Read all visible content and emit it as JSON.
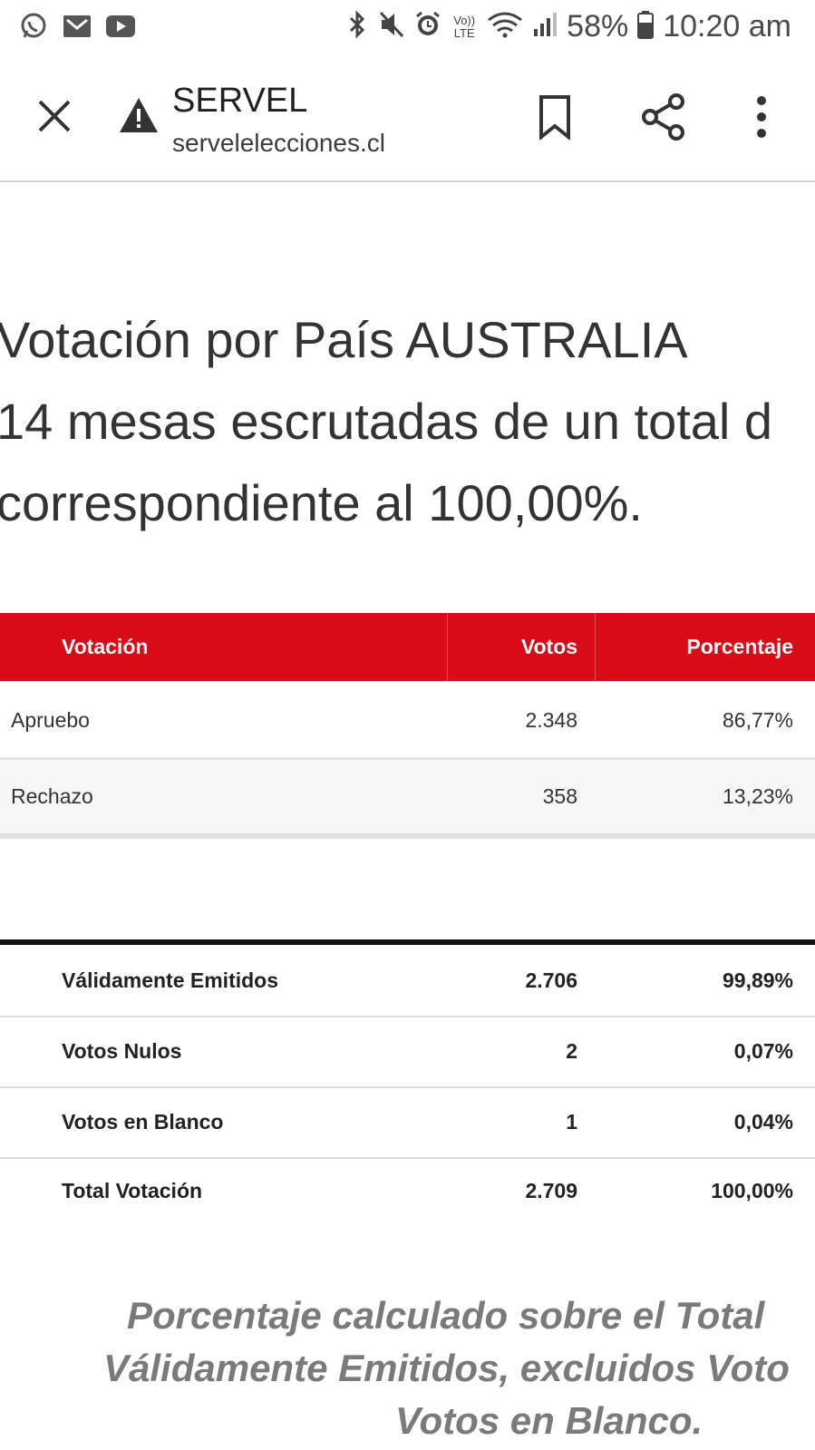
{
  "status_bar": {
    "left_icons": [
      "whatsapp-icon",
      "gmail-icon",
      "youtube-icon"
    ],
    "right_icons": [
      "bluetooth-icon",
      "mute-icon",
      "alarm-icon",
      "volte-icon",
      "wifi-icon",
      "signal-icon"
    ],
    "volte_label": "Vo)) LTE",
    "battery": "58%",
    "time": "10:20 am"
  },
  "toolbar": {
    "title": "SERVEL",
    "url": "servelelecciones.cl"
  },
  "heading": {
    "line1": "Votación por País AUSTRALIA",
    "line2": "14 mesas escrutadas de un total d",
    "line3": "correspondiente al 100,00%."
  },
  "results_table": {
    "headers": [
      "Votación",
      "Votos",
      "Porcentaje"
    ],
    "rows": [
      {
        "label": "Apruebo",
        "votes": "2.348",
        "pct": "86,77%"
      },
      {
        "label": "Rechazo",
        "votes": "358",
        "pct": "13,23%"
      }
    ]
  },
  "summary_table": {
    "rows": [
      {
        "label": "Válidamente Emitidos",
        "votes": "2.706",
        "pct": "99,89%"
      },
      {
        "label": "Votos Nulos",
        "votes": "2",
        "pct": "0,07%"
      },
      {
        "label": "Votos en Blanco",
        "votes": "1",
        "pct": "0,04%"
      },
      {
        "label": "Total Votación",
        "votes": "2.709",
        "pct": "100,00%"
      }
    ]
  },
  "footnote": {
    "line1": "Porcentaje calculado sobre el Total",
    "line2": "Válidamente Emitidos, excluidos Voto",
    "line3": "Votos en Blanco."
  },
  "colors": {
    "header_red": "#d90b18",
    "footnote_gray": "#7a7a7a"
  }
}
